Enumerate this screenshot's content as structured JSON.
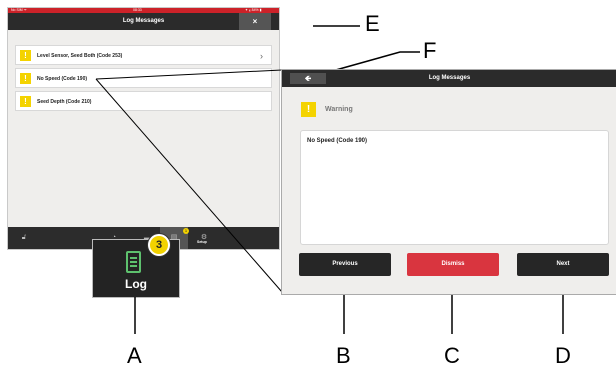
{
  "ipad": {
    "status_left": "No SIM ᯤ",
    "status_center": "08:33",
    "status_right": "✦ ⁎ 84% ▮",
    "title": "Log Messages",
    "close_icon": "×",
    "rows": [
      {
        "text": "Level Sensor, Seed Both (Code 253)",
        "chevron": "›"
      },
      {
        "text": "No Speed (Code 190)"
      },
      {
        "text": "Seed Depth (Code 210)"
      }
    ],
    "warning_glyph": "!",
    "setup_label": "Setup",
    "tab_badge": "1"
  },
  "log_button": {
    "label": "Log",
    "badge": "3"
  },
  "panel": {
    "title": "Log Messages",
    "back_icon": "🡸",
    "warning_label": "Warning",
    "message": "No Speed (Code 190)",
    "buttons": {
      "previous": "Previous",
      "dismiss": "Dismiss",
      "next": "Next"
    }
  },
  "callouts": {
    "A": "A",
    "B": "B",
    "C": "C",
    "D": "D",
    "E": "E",
    "F": "F"
  },
  "colors": {
    "red_bar": "#cc2229",
    "warning_yellow": "#f4d300",
    "dismiss_red": "#d9353f",
    "log_icon_green": "#5ec16e"
  }
}
